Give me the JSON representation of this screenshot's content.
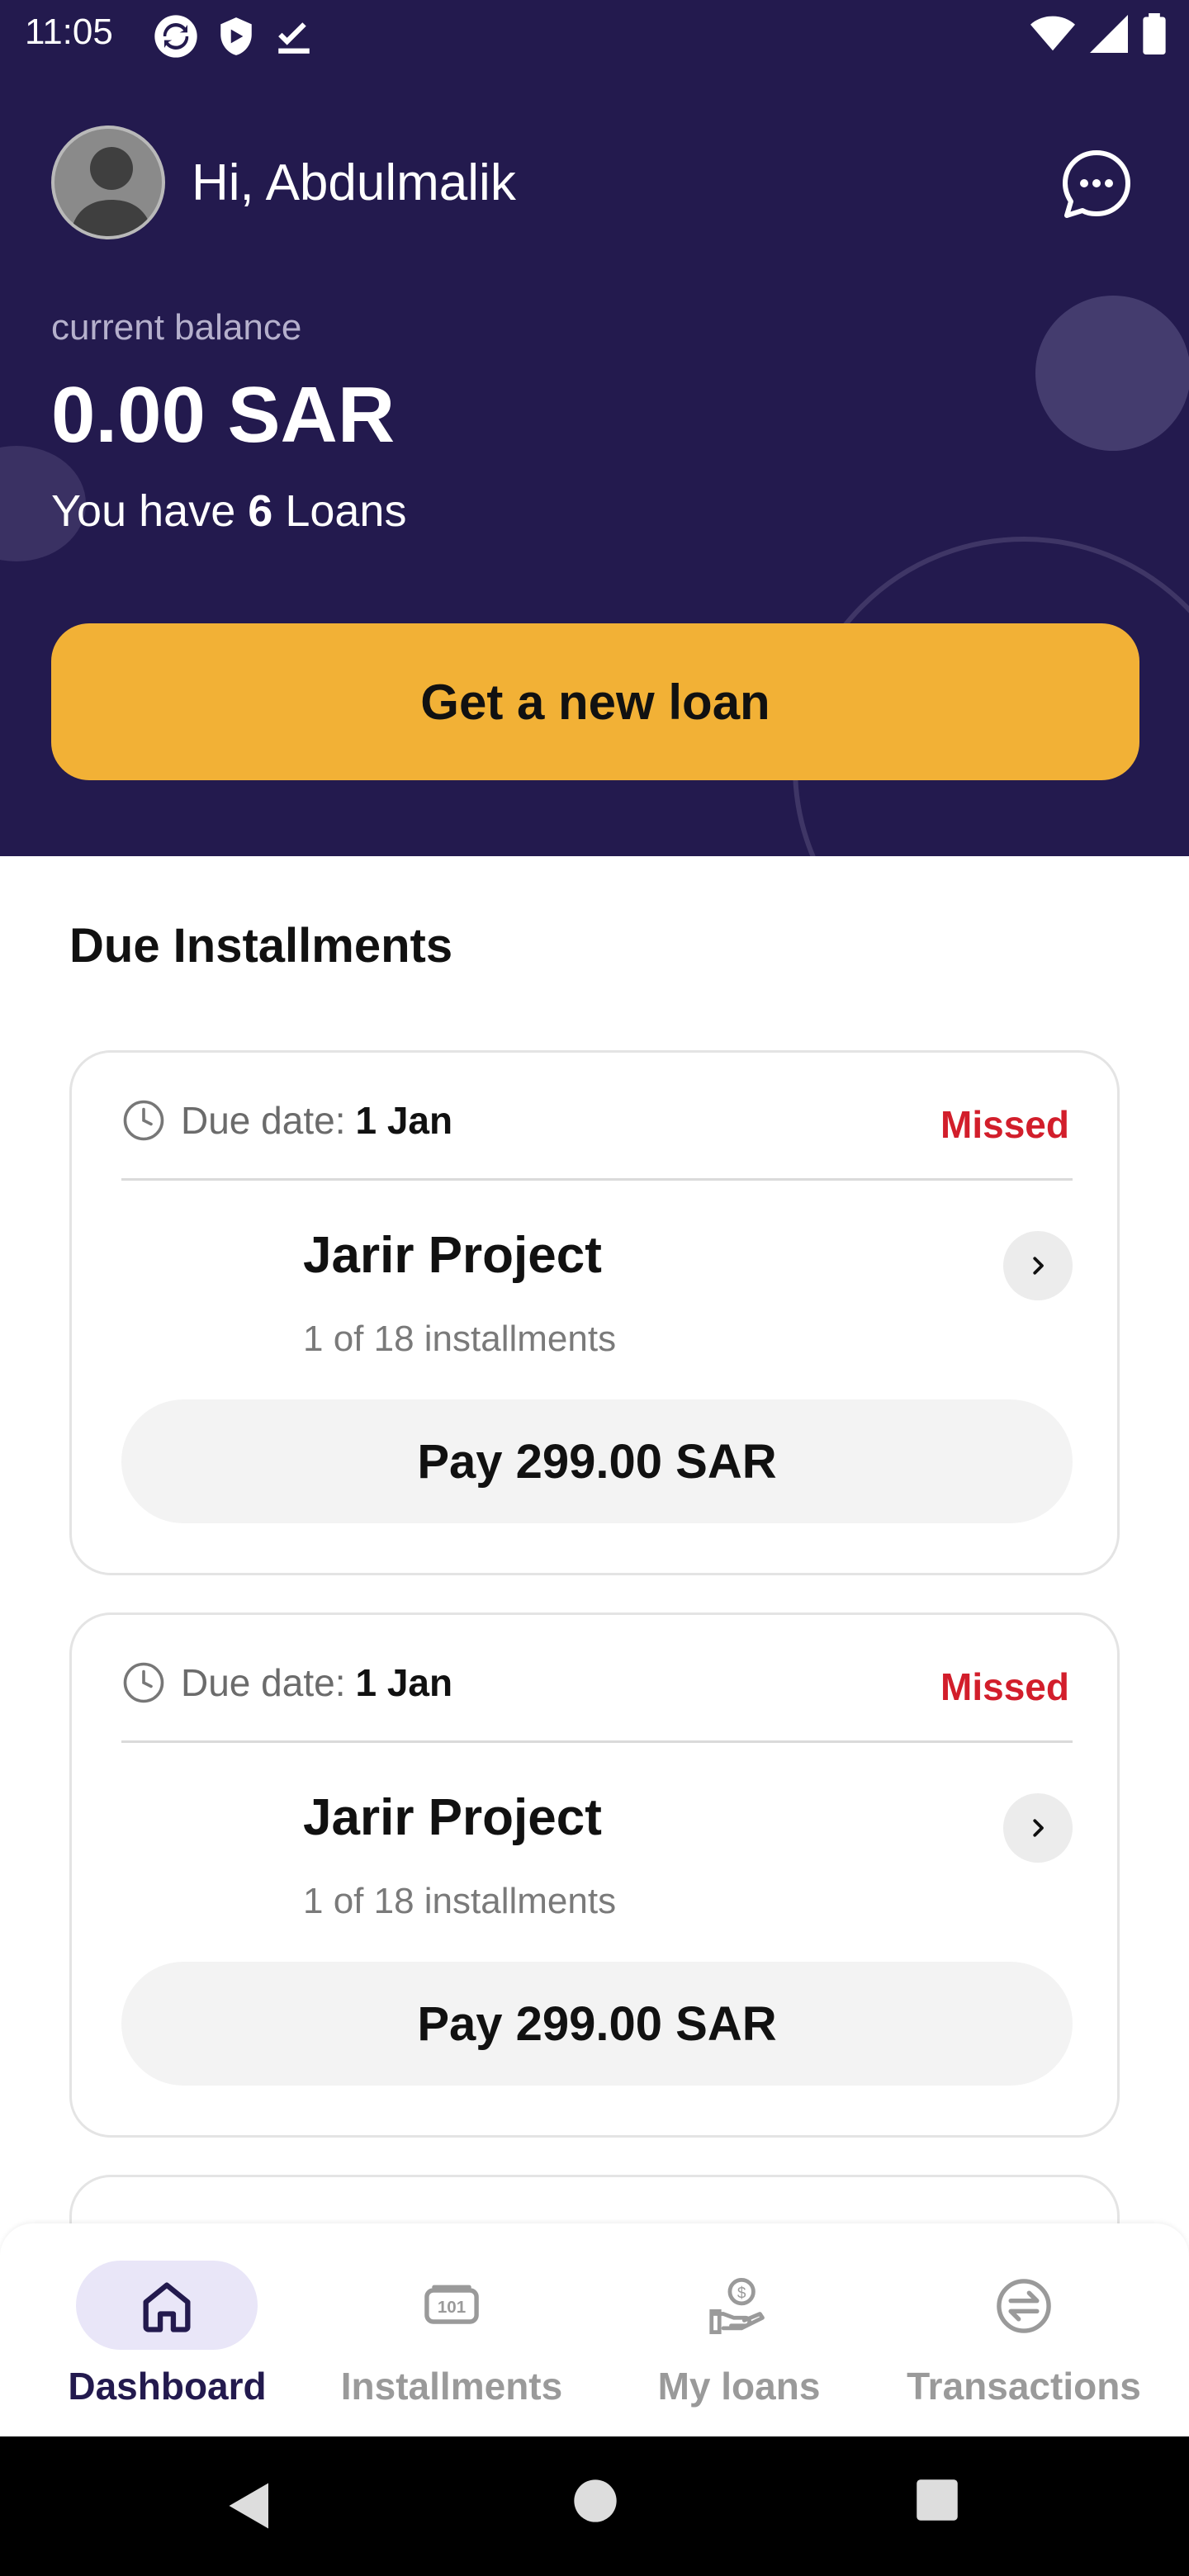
{
  "status_bar": {
    "time": "11:05",
    "left_icons": [
      "sync-icon",
      "shield-icon",
      "check-icon"
    ],
    "right_icons": [
      "wifi-icon",
      "signal-icon",
      "battery-icon"
    ]
  },
  "header": {
    "greeting": "Hi, Abdulmalik",
    "balance_label": "current balance",
    "balance_value": "0.00 SAR",
    "loans_prefix": "You have",
    "loans_count": "6",
    "loans_suffix": "Loans",
    "new_loan_label": "Get a new loan",
    "colors": {
      "background": "#231A4E",
      "accent": "#F2B136"
    }
  },
  "due_installments": {
    "title": "Due Installments",
    "items": [
      {
        "due_label": "Due date:",
        "due_date": "1 Jan",
        "status": "Missed",
        "project": "Jarir Project",
        "installments": "1 of 18 installments",
        "pay_label": "Pay 299.00 SAR"
      },
      {
        "due_label": "Due date:",
        "due_date": "1 Jan",
        "status": "Missed",
        "project": "Jarir Project",
        "installments": "1 of 18 installments",
        "pay_label": "Pay 299.00 SAR"
      }
    ],
    "status_color": "#D21E2B"
  },
  "bottom_nav": {
    "items": [
      {
        "label": "Dashboard",
        "icon": "home-icon",
        "active": true
      },
      {
        "label": "Installments",
        "icon": "cash-icon",
        "active": false
      },
      {
        "label": "My loans",
        "icon": "loan-hand-icon",
        "active": false
      },
      {
        "label": "Transactions",
        "icon": "exchange-icon",
        "active": false
      }
    ]
  }
}
